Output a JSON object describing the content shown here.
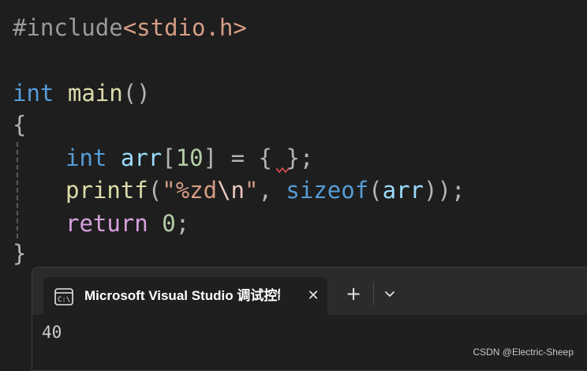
{
  "code": {
    "line1": {
      "directive": "#include",
      "header": "<stdio.h>"
    },
    "line3": {
      "type": "int",
      "func": "main",
      "parens": "()"
    },
    "line4": {
      "brace_open": "{"
    },
    "line5": {
      "type": "int",
      "var": "arr",
      "bracket_open": "[",
      "size": "10",
      "bracket_close": "]",
      "eq": " = ",
      "brace_open": "{",
      "space": " ",
      "brace_close": "}",
      "semi": ";"
    },
    "line6": {
      "func": "printf",
      "paren_open": "(",
      "str": "\"%zd",
      "esc": "\\n",
      "str_end": "\"",
      "comma": ", ",
      "op": "sizeof",
      "paren_open2": "(",
      "arg": "arr",
      "paren_close": "))",
      "semi": ";"
    },
    "line7": {
      "kw": "return",
      "space": " ",
      "num": "0",
      "semi": ";"
    },
    "line8": {
      "brace_close": "}"
    }
  },
  "terminal": {
    "tab_title": "Microsoft Visual Studio 调试控制台",
    "close_glyph": "✕",
    "add_glyph": "+",
    "dropdown_icon": "chevron-down-icon",
    "console_icon": "console-icon",
    "output": "40"
  },
  "watermark": "CSDN @Electric-Sheep",
  "colors": {
    "editor_bg": "#1e1e1e",
    "keyword": "#569cd6",
    "function": "#dcdcaa",
    "variable": "#9cdcfe",
    "number": "#b5cea8",
    "string": "#d69d85",
    "control": "#d8a0df",
    "error_squiggle": "#e05050"
  }
}
